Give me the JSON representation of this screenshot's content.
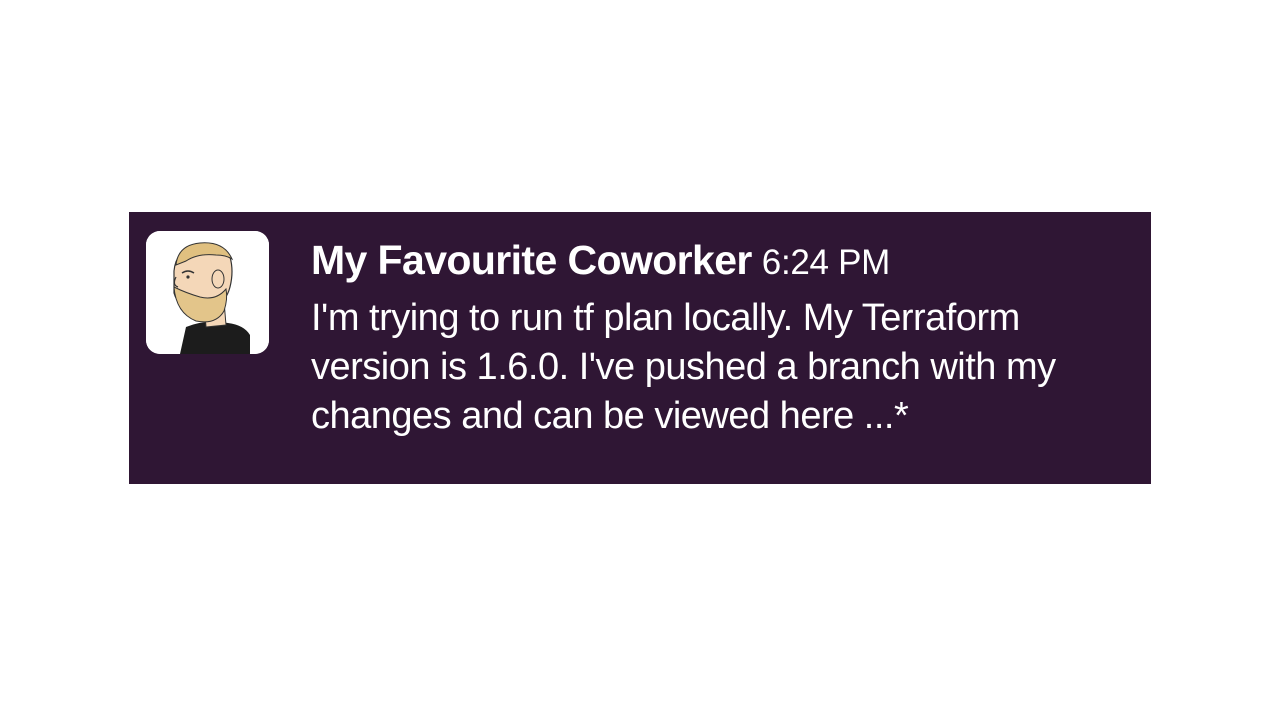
{
  "message": {
    "sender_name": "My Favourite Coworker",
    "timestamp": "6:24 PM",
    "lines": [
      "I'm trying to run tf plan locally. My Terraform",
      "version is 1.6.0. I've pushed a branch with my",
      "changes and can be viewed here ...*"
    ],
    "avatar_icon": "chad-yes-meme-avatar-icon"
  },
  "colors": {
    "card_background": "#2f1634",
    "text": "#ffffff",
    "page_background": "#ffffff"
  }
}
